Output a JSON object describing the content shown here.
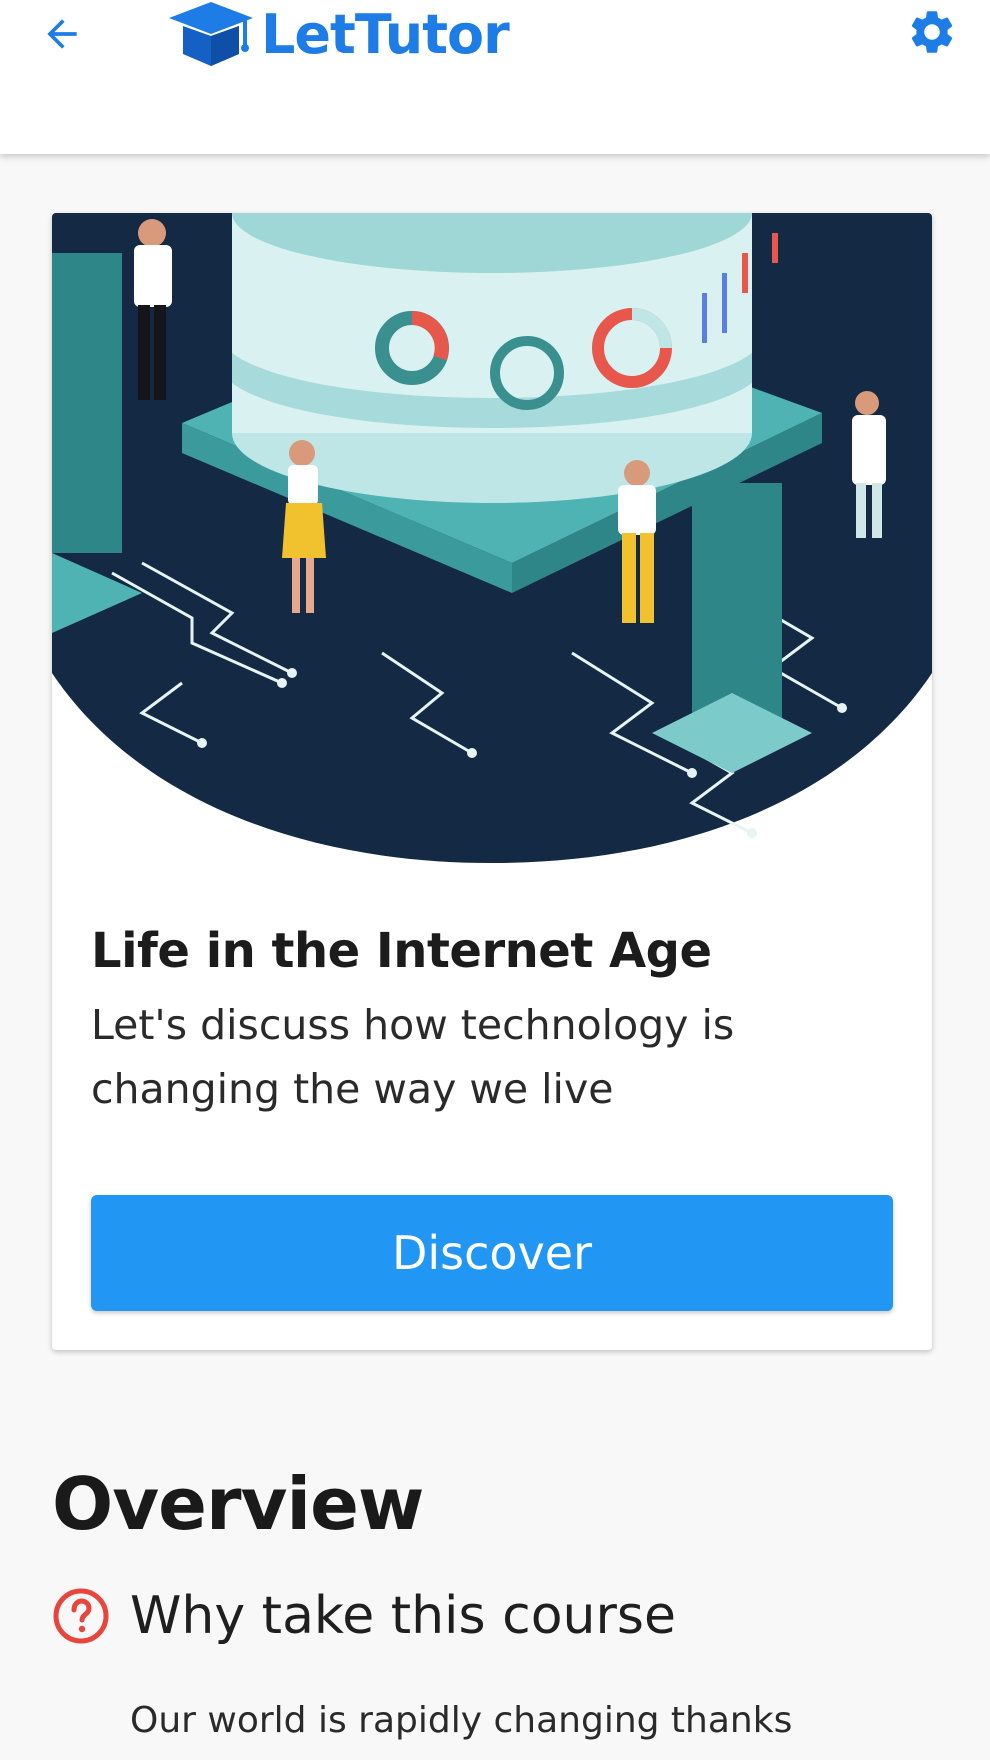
{
  "header": {
    "app_name": "LetTutor",
    "back_icon": "arrow-left-icon",
    "settings_icon": "gear-icon",
    "brand_color": "#1e7ce6"
  },
  "course": {
    "title": "Life in the Internet Age",
    "subtitle": "Let's discuss how technology is changing the way we live",
    "button_label": "Discover",
    "button_color": "#2196f3"
  },
  "overview": {
    "heading": "Overview",
    "section_icon": "question-circle-icon",
    "section_title": "Why take this course",
    "section_text": "Our world is rapidly changing thanks",
    "accent_color": "#e8453c"
  }
}
